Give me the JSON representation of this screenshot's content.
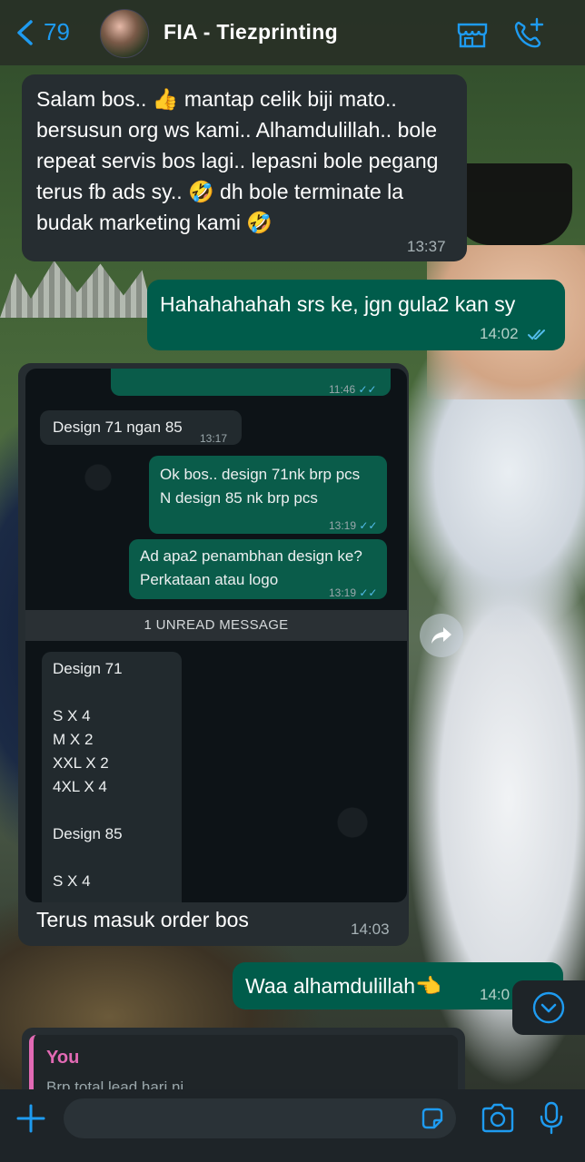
{
  "header": {
    "back_count": "79",
    "title": "FIA - Tiezprinting",
    "icons": [
      "store-icon",
      "call-add-icon"
    ]
  },
  "accent_color": "#1e9bf0",
  "messages": [
    {
      "direction": "incoming",
      "text": "Salam bos.. 👍 mantap celik biji mato.. bersusun org ws kami.. Alhamdulillah.. bole repeat servis bos lagi.. lepasni bole pegang terus fb ads sy.. 🤣 dh bole terminate la budak marketing kami 🤣",
      "time": "13:37"
    },
    {
      "direction": "outgoing",
      "text": "Hahahahahah srs ke, jgn gula2 kan sy",
      "time": "14:02"
    },
    {
      "direction": "incoming",
      "type": "image",
      "caption": "Terus masuk order bos",
      "time": "14:03"
    },
    {
      "direction": "outgoing",
      "text": "Waa alhamdulillah👈",
      "time": "14:0"
    }
  ],
  "embedded": {
    "top_time": "11:46",
    "m1": {
      "text": "Design 71 ngan 85",
      "time": "13:17"
    },
    "m2": {
      "line1": "Ok bos.. design 71nk brp pcs",
      "line2": "N design 85 nk brp pcs",
      "time": "13:19"
    },
    "m3": {
      "line1": "Ad apa2 penambhan design ke?",
      "line2": "Perkataan atau logo",
      "time": "13:19"
    },
    "unread_label": "1 UNREAD MESSAGE",
    "order_lines": [
      "Design 71",
      "",
      "S X 4",
      "M X 2",
      "XXL X 2",
      "4XL X 4",
      "",
      "Design 85",
      "",
      "S X 4"
    ]
  },
  "reply_preview": {
    "author": "You",
    "text": "Brp total lead hari ni"
  },
  "input": {
    "placeholder": ""
  }
}
